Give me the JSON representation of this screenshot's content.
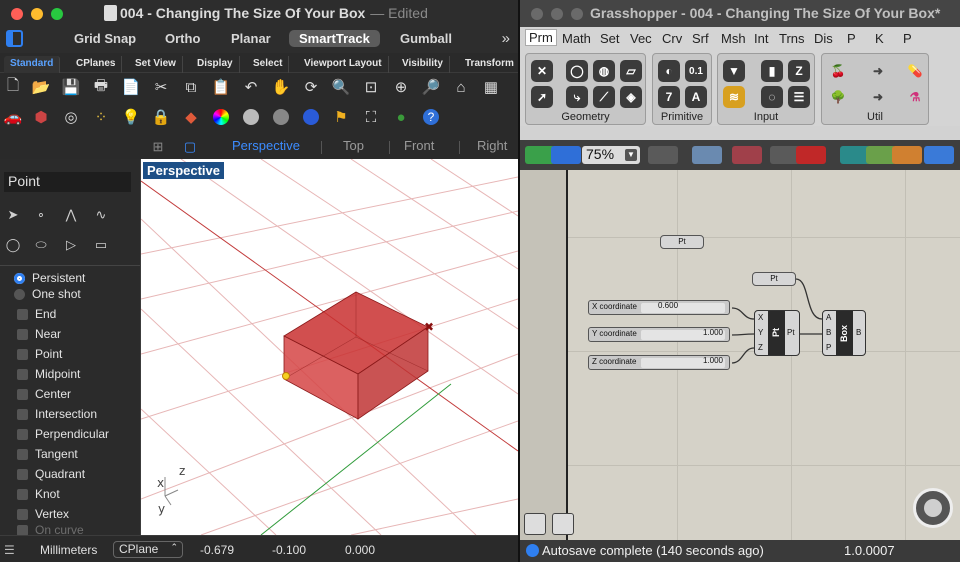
{
  "rhino": {
    "title": "004 - Changing The Size Of Your Box",
    "title_status": "— Edited",
    "modes": [
      "Grid Snap",
      "Ortho",
      "Planar",
      "SmartTrack",
      "Gumball"
    ],
    "active_mode": "SmartTrack",
    "tabs": [
      "Standard",
      "CPlanes",
      "Set View",
      "Display",
      "Select",
      "Viewport Layout",
      "Visibility",
      "Transform"
    ],
    "active_tab": "Standard",
    "view_tabs": [
      "Perspective",
      "Top",
      "Front",
      "Right"
    ],
    "active_view": "Perspective",
    "viewport_label": "Perspective",
    "command_field": "Point",
    "osnap_modes": {
      "radios": [
        {
          "label": "Persistent",
          "selected": true
        },
        {
          "label": "One shot",
          "selected": false
        }
      ],
      "checks": [
        "End",
        "Near",
        "Point",
        "Midpoint",
        "Center",
        "Intersection",
        "Perpendicular",
        "Tangent",
        "Quadrant",
        "Knot",
        "Vertex",
        "On curve"
      ]
    },
    "axis_labels": {
      "x": "x",
      "y": "y",
      "z": "z"
    },
    "status": {
      "units": "Millimeters",
      "cplane": "CPlane",
      "x": "-0.679",
      "y": "-0.100",
      "z": "0.000"
    }
  },
  "grasshopper": {
    "title": "Grasshopper - 004 - Changing The Size Of Your Box*",
    "menu_tabs": [
      "Prm",
      "Math",
      "Set",
      "Vec",
      "Crv",
      "Srf",
      "Msh",
      "Int",
      "Trns",
      "Dis",
      "P",
      "K",
      "P"
    ],
    "active_menu_tab": "Prm",
    "ribbon_groups": [
      "Geometry",
      "Primitive",
      "Input",
      "Util"
    ],
    "zoom": "75%",
    "nodes": {
      "pt_param_1": "Pt",
      "pt_param_2": "Pt",
      "construct_point": {
        "name": "Pt",
        "inputs": [
          "X",
          "Y",
          "Z"
        ],
        "output": "Pt"
      },
      "box": {
        "name": "Box",
        "inputs": [
          "A",
          "B",
          "P"
        ],
        "output": "B"
      }
    },
    "sliders": [
      {
        "name": "X coordinate",
        "value": "0.600"
      },
      {
        "name": "Y coordinate",
        "value": "1.000"
      },
      {
        "name": "Z coordinate",
        "value": "1.000"
      }
    ],
    "status": {
      "message": "Autosave complete (140 seconds ago)",
      "version": "1.0.0007"
    }
  },
  "colors": {
    "accent": "#2f7ff0",
    "box_fill": "#d42a2a",
    "grid_red": "#c23a3a",
    "grid_green": "#2f9b3a"
  }
}
